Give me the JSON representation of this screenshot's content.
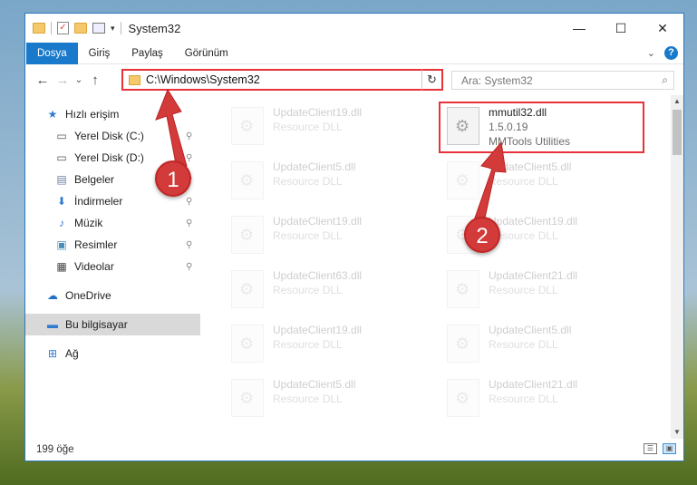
{
  "window": {
    "title": "System32",
    "controls": {
      "minimize": "—",
      "maximize": "☐",
      "close": "✕"
    }
  },
  "ribbon": {
    "tabs": [
      "Dosya",
      "Giriş",
      "Paylaş",
      "Görünüm"
    ],
    "active_tab": "Dosya",
    "collapse_glyph": "⌄",
    "help_glyph": "?"
  },
  "nav": {
    "back": "←",
    "forward": "→",
    "recent": "⌄",
    "up": "↑",
    "address": "C:\\Windows\\System32",
    "address_dropdown": "⌄",
    "refresh": "↻",
    "search_placeholder": "Ara: System32",
    "search_icon": "⌕"
  },
  "sidebar": {
    "items": [
      {
        "label": "Hızlı erişim",
        "icon": "star-icon",
        "glyph": "★",
        "color": "#2f7bd1",
        "pinned": false
      },
      {
        "label": "Yerel Disk (C:)",
        "icon": "drive-icon",
        "glyph": "▭",
        "color": "#555555",
        "pinned": true
      },
      {
        "label": "Yerel Disk (D:)",
        "icon": "drive-icon",
        "glyph": "▭",
        "color": "#555555",
        "pinned": true
      },
      {
        "label": "Belgeler",
        "icon": "documents-icon",
        "glyph": "▤",
        "color": "#6b7fa3",
        "pinned": true
      },
      {
        "label": "İndirmeler",
        "icon": "downloads-icon",
        "glyph": "⬇",
        "color": "#2f7bd1",
        "pinned": true
      },
      {
        "label": "Müzik",
        "icon": "music-icon",
        "glyph": "♪",
        "color": "#2f7bd1",
        "pinned": true
      },
      {
        "label": "Resimler",
        "icon": "pictures-icon",
        "glyph": "▣",
        "color": "#4a8db8",
        "pinned": true
      },
      {
        "label": "Videolar",
        "icon": "videos-icon",
        "glyph": "▦",
        "color": "#444444",
        "pinned": true
      },
      {
        "label": "OneDrive",
        "icon": "onedrive-icon",
        "glyph": "☁",
        "color": "#1f6fc5",
        "pinned": false
      },
      {
        "label": "Bu bilgisayar",
        "icon": "computer-icon",
        "glyph": "▬",
        "color": "#2f7bd1",
        "pinned": false
      },
      {
        "label": "Ağ",
        "icon": "network-icon",
        "glyph": "⊞",
        "color": "#2f7bd1",
        "pinned": false
      }
    ],
    "pin_glyph": "📌",
    "selected": "Bu bilgisayar"
  },
  "files": [
    {
      "name": "UpdateClient19.dll",
      "type": "Resource DLL",
      "faded": true
    },
    {
      "name": "mmutil32.dll",
      "type": "1.5.0.19",
      "company": "MMTools Utilities",
      "faded": false
    },
    {
      "name": "UpdateClient5.dll",
      "type": "Resource DLL",
      "faded": true
    },
    {
      "name": "UpdateClient5.dll",
      "type": "Resource DLL",
      "faded": true
    },
    {
      "name": "UpdateClient19.dll",
      "type": "Resource DLL",
      "faded": true
    },
    {
      "name": "UpdateClient19.dll",
      "type": "Resource DLL",
      "faded": true
    },
    {
      "name": "UpdateClient63.dll",
      "type": "Resource DLL",
      "faded": true
    },
    {
      "name": "UpdateClient21.dll",
      "type": "Resource DLL",
      "faded": true
    },
    {
      "name": "UpdateClient19.dll",
      "type": "Resource DLL",
      "faded": true
    },
    {
      "name": "UpdateClient5.dll",
      "type": "Resource DLL",
      "faded": true
    },
    {
      "name": "UpdateClient5.dll",
      "type": "Resource DLL",
      "faded": true
    },
    {
      "name": "UpdateClient21.dll",
      "type": "Resource DLL",
      "faded": true
    }
  ],
  "status": {
    "count": "199 öğe"
  },
  "annotations": {
    "step1": "1",
    "step2": "2",
    "color": "#d33a3a"
  },
  "scroll": {
    "up": "▲",
    "down": "▼"
  }
}
